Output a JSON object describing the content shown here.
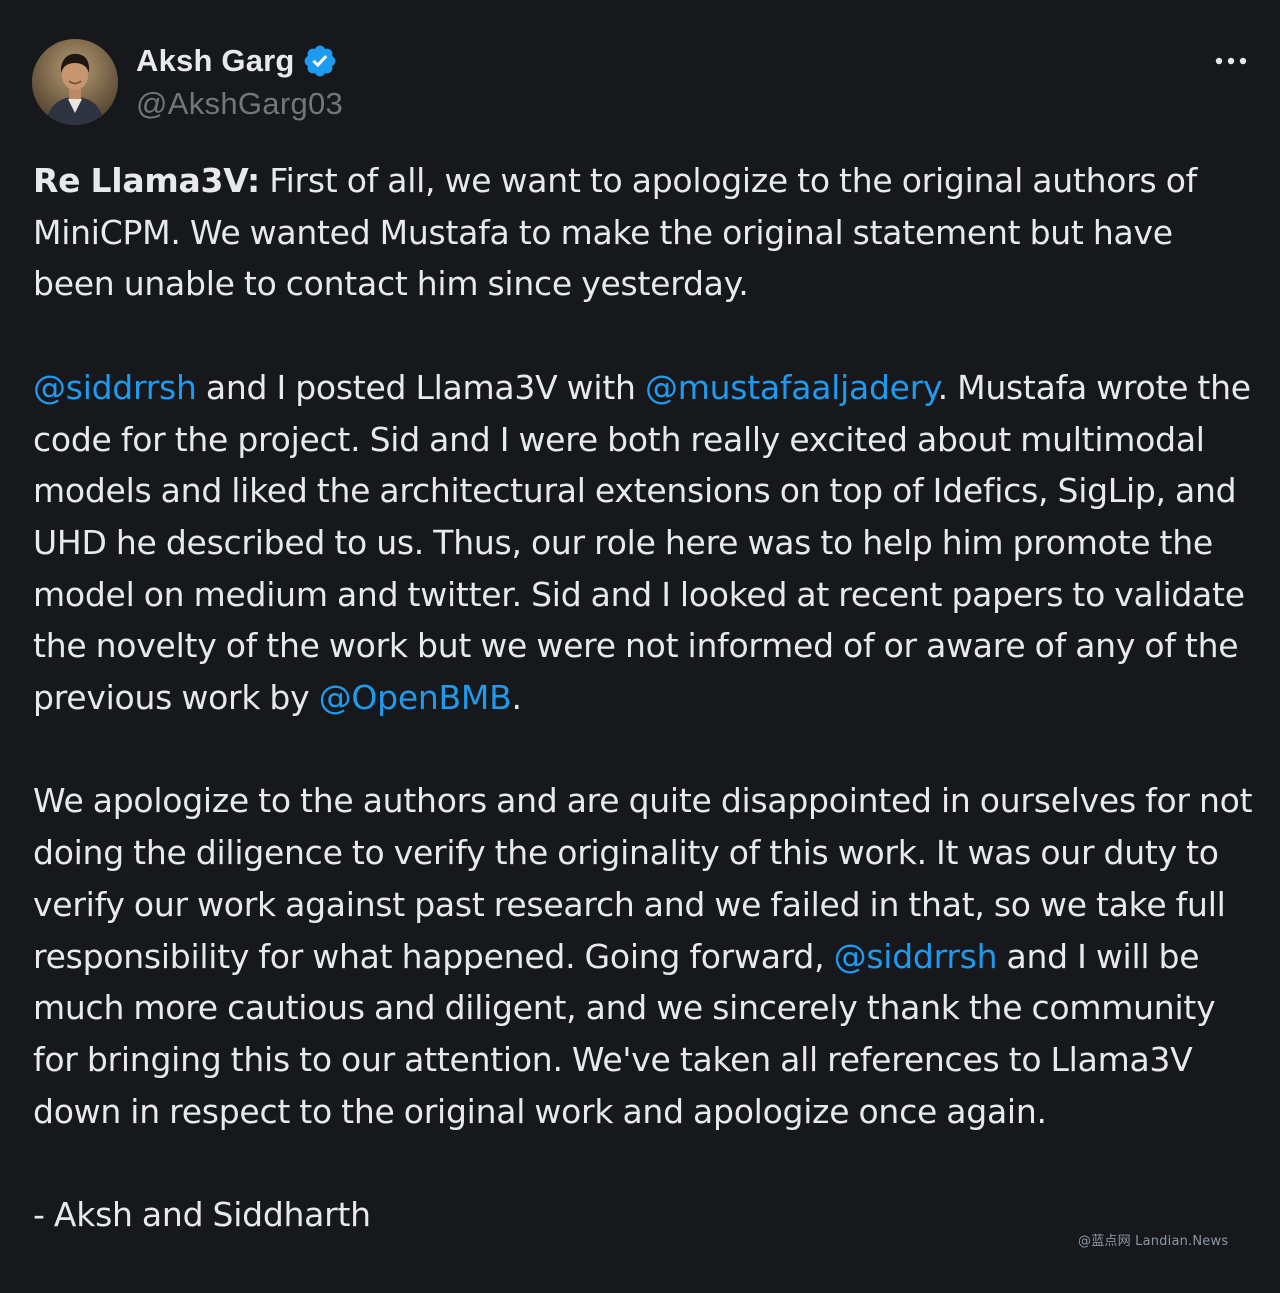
{
  "author": {
    "display_name": "Aksh Garg",
    "handle": "@AkshGarg03",
    "verified_icon": "verified-badge-icon",
    "avatar": "avatar-photo"
  },
  "actions": {
    "more_icon": "more-options-icon"
  },
  "tweet": {
    "p1": {
      "lede": "Re Llama3V:",
      "text": " First of all, we want to apologize to the original authors of MiniCPM. We wanted Mustafa to make the original statement but have been unable to contact him since yesterday."
    },
    "p2": {
      "mention1": "@siddrrsh",
      "text1": " and I posted Llama3V with ",
      "mention2": "@mustafaaljadery",
      "text2": ". Mustafa wrote the code for the project. Sid and I were both really excited about multimodal models and liked the architectural extensions on top of Idefics, SigLip, and UHD he described to us. Thus, our role here was to help him promote the model on medium and twitter. Sid and I looked at recent papers to validate the novelty of the work but we were not informed of or aware of any of the previous work by ",
      "mention3": "@OpenBMB",
      "text3": "."
    },
    "p3": {
      "text1": "We apologize to the authors and are quite disappointed in ourselves for not doing the diligence to verify the originality of this work. It was our duty to verify our work against past research and we failed in that, so we take full responsibility for what happened. Going forward, ",
      "mention1": "@siddrrsh",
      "text2": " and I will be much more cautious and diligent, and we sincerely thank the community for bringing this to our attention. We've taken all references to Llama3V down in respect to the original work and apologize once again."
    },
    "signature": "- Aksh and Siddharth"
  },
  "watermark": "@蓝点网 Landian.News",
  "colors": {
    "background": "#17181c",
    "text": "#e7e9ea",
    "secondary": "#71767b",
    "accent": "#1d9bf0"
  }
}
